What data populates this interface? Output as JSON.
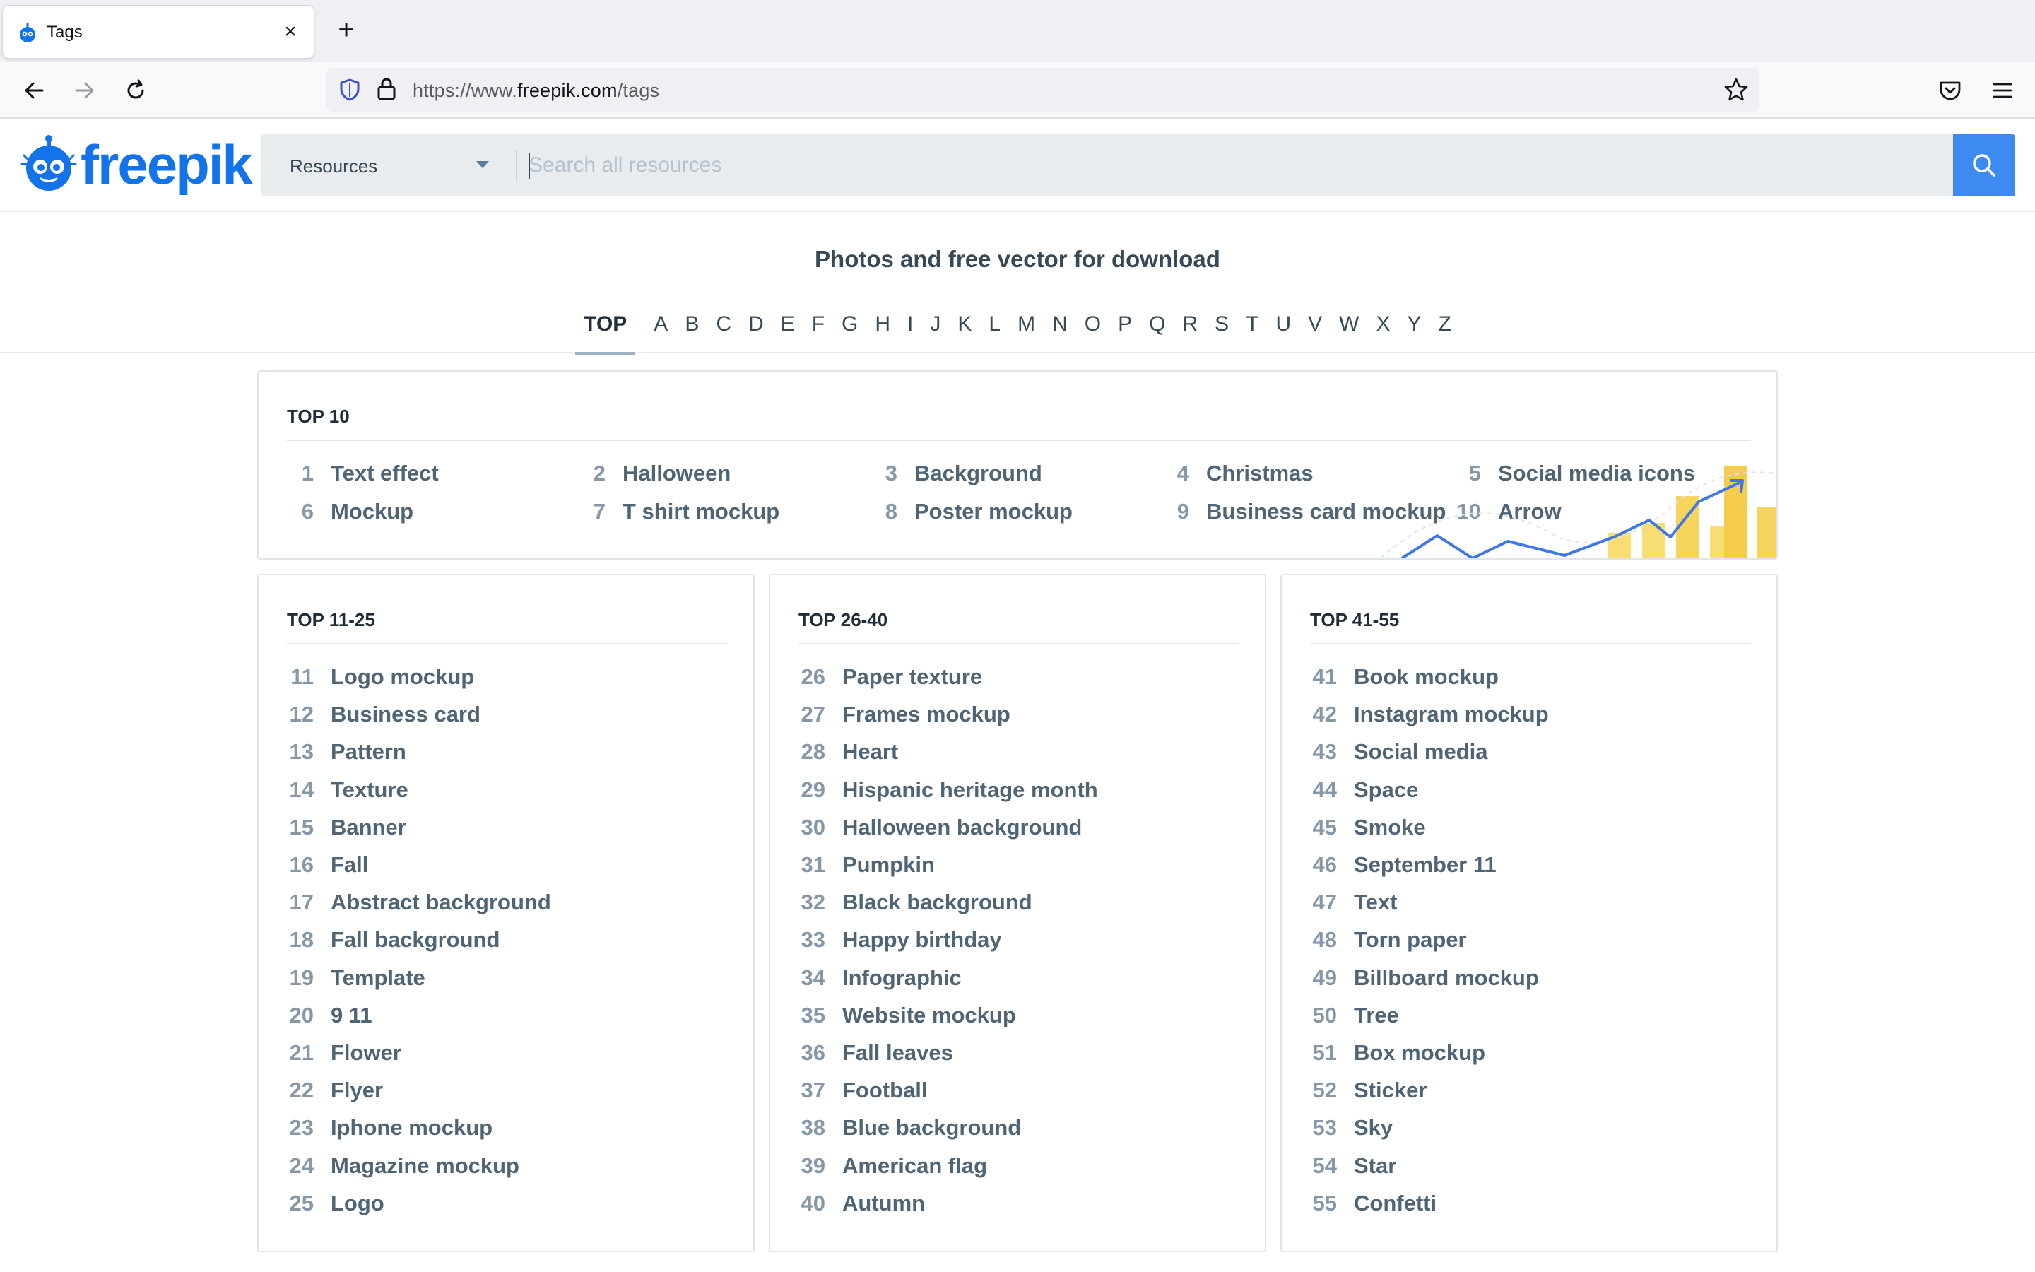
{
  "browser": {
    "tab_title": "Tags",
    "tab_close": "×",
    "new_tab": "+",
    "url_prefix": "https://www.",
    "url_host": "freepik.com",
    "url_path": "/tags"
  },
  "header": {
    "logo_text": "freepik",
    "resources_label": "Resources",
    "search_placeholder": "Search all resources",
    "accent_color": "#1273eb",
    "search_button_color": "#3d8bf2"
  },
  "page": {
    "title": "Photos and free vector for download"
  },
  "alphabet": [
    "TOP",
    "A",
    "B",
    "C",
    "D",
    "E",
    "F",
    "G",
    "H",
    "I",
    "J",
    "K",
    "L",
    "M",
    "N",
    "O",
    "P",
    "Q",
    "R",
    "S",
    "T",
    "U",
    "V",
    "W",
    "X",
    "Y",
    "Z"
  ],
  "alphabet_active": "TOP",
  "top10": {
    "title": "TOP 10",
    "items": [
      {
        "num": "1",
        "label": "Text effect"
      },
      {
        "num": "2",
        "label": "Halloween"
      },
      {
        "num": "3",
        "label": "Background"
      },
      {
        "num": "4",
        "label": "Christmas"
      },
      {
        "num": "5",
        "label": "Social media icons"
      },
      {
        "num": "6",
        "label": "Mockup"
      },
      {
        "num": "7",
        "label": "T shirt mockup"
      },
      {
        "num": "8",
        "label": "Poster mockup"
      },
      {
        "num": "9",
        "label": "Business card mockup"
      },
      {
        "num": "10",
        "label": "Arrow"
      }
    ]
  },
  "columns": [
    {
      "title": "TOP 11-25",
      "items": [
        {
          "num": "11",
          "label": "Logo mockup"
        },
        {
          "num": "12",
          "label": "Business card"
        },
        {
          "num": "13",
          "label": "Pattern"
        },
        {
          "num": "14",
          "label": "Texture"
        },
        {
          "num": "15",
          "label": "Banner"
        },
        {
          "num": "16",
          "label": "Fall"
        },
        {
          "num": "17",
          "label": "Abstract background"
        },
        {
          "num": "18",
          "label": "Fall background"
        },
        {
          "num": "19",
          "label": "Template"
        },
        {
          "num": "20",
          "label": "9 11"
        },
        {
          "num": "21",
          "label": "Flower"
        },
        {
          "num": "22",
          "label": "Flyer"
        },
        {
          "num": "23",
          "label": "Iphone mockup"
        },
        {
          "num": "24",
          "label": "Magazine mockup"
        },
        {
          "num": "25",
          "label": "Logo"
        }
      ]
    },
    {
      "title": "TOP 26-40",
      "items": [
        {
          "num": "26",
          "label": "Paper texture"
        },
        {
          "num": "27",
          "label": "Frames mockup"
        },
        {
          "num": "28",
          "label": "Heart"
        },
        {
          "num": "29",
          "label": "Hispanic heritage month"
        },
        {
          "num": "30",
          "label": "Halloween background"
        },
        {
          "num": "31",
          "label": "Pumpkin"
        },
        {
          "num": "32",
          "label": "Black background"
        },
        {
          "num": "33",
          "label": "Happy birthday"
        },
        {
          "num": "34",
          "label": "Infographic"
        },
        {
          "num": "35",
          "label": "Website mockup"
        },
        {
          "num": "36",
          "label": "Fall leaves"
        },
        {
          "num": "37",
          "label": "Football"
        },
        {
          "num": "38",
          "label": "Blue background"
        },
        {
          "num": "39",
          "label": "American flag"
        },
        {
          "num": "40",
          "label": "Autumn"
        }
      ]
    },
    {
      "title": "TOP 41-55",
      "items": [
        {
          "num": "41",
          "label": "Book mockup"
        },
        {
          "num": "42",
          "label": "Instagram mockup"
        },
        {
          "num": "43",
          "label": "Social media"
        },
        {
          "num": "44",
          "label": "Space"
        },
        {
          "num": "45",
          "label": "Smoke"
        },
        {
          "num": "46",
          "label": "September 11"
        },
        {
          "num": "47",
          "label": "Text"
        },
        {
          "num": "48",
          "label": "Torn paper"
        },
        {
          "num": "49",
          "label": "Billboard mockup"
        },
        {
          "num": "50",
          "label": "Tree"
        },
        {
          "num": "51",
          "label": "Box mockup"
        },
        {
          "num": "52",
          "label": "Sticker"
        },
        {
          "num": "53",
          "label": "Sky"
        },
        {
          "num": "54",
          "label": "Star"
        },
        {
          "num": "55",
          "label": "Confetti"
        }
      ]
    }
  ]
}
